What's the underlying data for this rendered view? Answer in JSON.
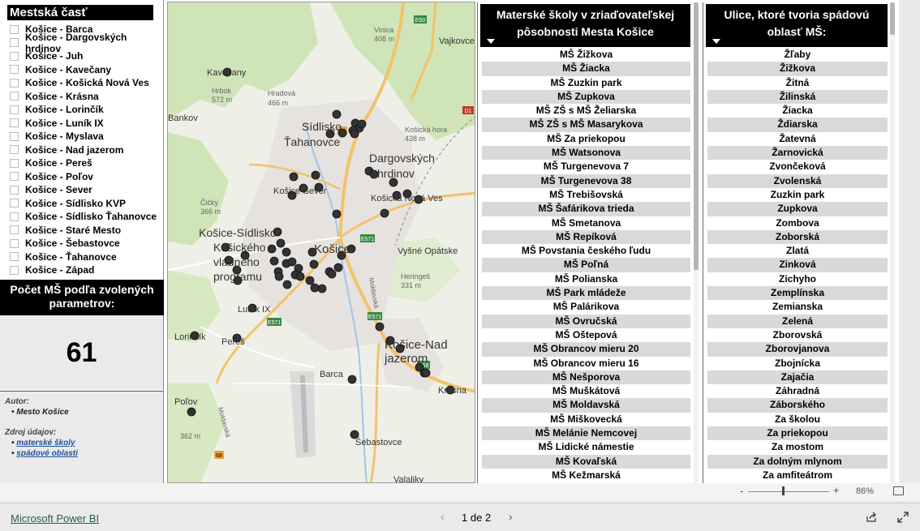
{
  "slicer": {
    "title": "Mestská časť",
    "items": [
      "Košice - Barca",
      "Košice - Dargovských hrdinov",
      "Košice - Juh",
      "Košice - Kavečany",
      "Košice - Košická Nová Ves",
      "Košice - Krásna",
      "Košice - Lorinčík",
      "Košice - Luník IX",
      "Košice - Myslava",
      "Košice - Nad jazerom",
      "Košice - Pereš",
      "Košice - Poľov",
      "Košice - Sever",
      "Košice - Sídlisko KVP",
      "Košice - Sídlisko Ťahanovce",
      "Košice - Staré Mesto",
      "Košice - Šebastovce",
      "Košice - Ťahanovce",
      "Košice - Západ"
    ]
  },
  "kpi": {
    "title": "Počet MŠ podľa zvolených parametrov:",
    "value": "61"
  },
  "info": {
    "author_label": "Autor:",
    "author": "Mesto Košice",
    "source_label": "Zdroj údajov:",
    "links": [
      "materské školy",
      "spádové oblasti"
    ]
  },
  "map": {
    "labels": [
      "Kavečany",
      "Hrbok",
      "572 m",
      "Bankov",
      "Hradová",
      "466 m",
      "Sídlisko",
      "Ťahanovce",
      "Vinica",
      "408 m",
      "Vajkovce",
      "Košická hora",
      "438 m",
      "Dargovských",
      "hrdinov",
      "Čičky",
      "366 m",
      "Košice-Sever",
      "Košická Nová Ves",
      "Košice-Sídlisko",
      "Košického",
      "vládneho",
      "programu",
      "Košice",
      "Vyšné Opátske",
      "Heringeš",
      "331 m",
      "Luník IX",
      "Lorinčík",
      "Pereš",
      "Košice-Nad",
      "jazerom",
      "Barca",
      "Krásna",
      "Poľov",
      "362 m",
      "Šebastovce",
      "Valaliky",
      "E50",
      "E571",
      "E58",
      "16",
      "D1",
      "68",
      "Moldavská"
    ]
  },
  "schools": {
    "header": "Materské školy v zriaďovateľskej pôsobnosti Mesta Košice",
    "rows": [
      "MŠ Žižkova",
      "MŠ Žiacka",
      "MŠ Zuzkin park",
      "MŠ Zupkova",
      "MŠ ZŠ s MŠ Želiarska",
      "MŠ ZŠ s MŠ Masarykova",
      "MŠ Za priekopou",
      "MŠ Watsonova",
      "MŠ Turgenevova 7",
      "MŠ Turgenevova 38",
      "MŠ Trebišovská",
      "MŠ Šafárikova trieda",
      "MŠ Smetanova",
      "MŠ Repíková",
      "MŠ Povstania českého ľudu",
      "MŠ Poľná",
      "MŠ Polianska",
      "MŠ Park mládeže",
      "MŠ Palárikova",
      "MŠ Ovručská",
      "MŠ Oštepová",
      "MŠ Obrancov mieru 20",
      "MŠ Obrancov mieru 16",
      "MŠ Nešporova",
      "MŠ Muškátová",
      "MŠ Moldavská",
      "MŠ Miškovecká",
      "MŠ Melánie Nemcovej",
      "MŠ Lidické námestie",
      "MŠ Kovaľská",
      "MŠ Kežmarská"
    ]
  },
  "streets": {
    "header": "Ulice, ktoré tvoria spádovú oblasť MŠ:",
    "rows": [
      "Žľaby",
      "Žižkova",
      "Žitná",
      "Žilinská",
      "Žiacka",
      "Ždiarska",
      "Žatevná",
      "Žarnovická",
      "Zvončeková",
      "Zvolenská",
      "Zuzkin park",
      "Zupkova",
      "Zombova",
      "Zoborská",
      "Zlatá",
      "Zinková",
      "Zichyho",
      "Zemplínska",
      "Zemianska",
      "Zelená",
      "Zborovská",
      "Zborovjanova",
      "Zbojnícka",
      "Zajačia",
      "Záhradná",
      "Záborského",
      "Za školou",
      "Za priekopou",
      "Za mostom",
      "Za dolným mlynom",
      "Za amfiteátrom"
    ]
  },
  "zoom": {
    "minus": "-",
    "plus": "+",
    "percent": "86%"
  },
  "footer": {
    "brand": "Microsoft Power BI",
    "page": "1 de 2"
  },
  "colors": {
    "header_bg": "#000000",
    "alt_row": "#d9d9d9",
    "marker": "#333333"
  }
}
